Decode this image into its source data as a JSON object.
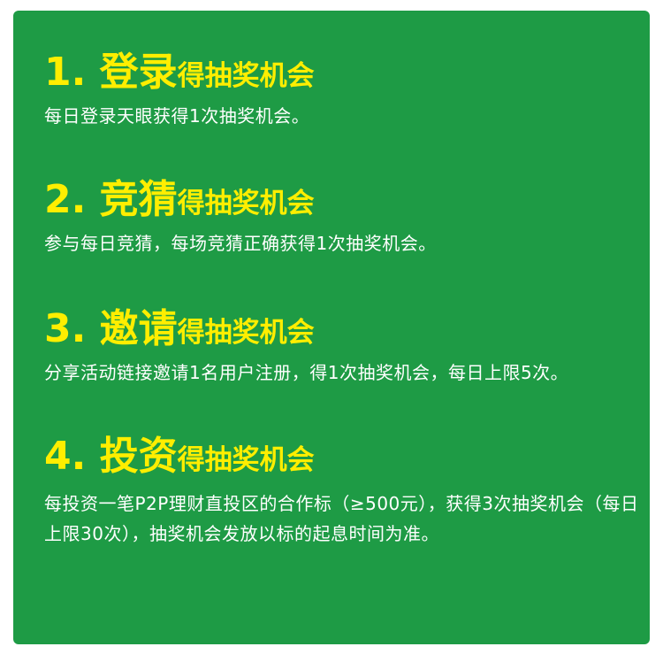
{
  "items": [
    {
      "number": "1. ",
      "keyword": "登录",
      "suffix": "得抽奖机会",
      "description": "每日登录天眼获得1次抽奖机会。"
    },
    {
      "number": "2. ",
      "keyword": "竞猜",
      "suffix": "得抽奖机会",
      "description": "参与每日竞猜，每场竞猜正确获得1次抽奖机会。"
    },
    {
      "number": "3. ",
      "keyword": "邀请",
      "suffix": "得抽奖机会",
      "description": "分享活动链接邀请1名用户注册，得1次抽奖机会，每日上限5次。"
    },
    {
      "number": "4. ",
      "keyword": "投资",
      "suffix": "得抽奖机会",
      "description": "每投资一笔P2P理财直投区的合作标（≥500元），获得3次抽奖机会（每日上限30次），抽奖机会发放以标的起息时间为准。"
    }
  ],
  "colors": {
    "background": "#1e9b45",
    "heading": "#ffee00",
    "text": "#ffffff"
  }
}
